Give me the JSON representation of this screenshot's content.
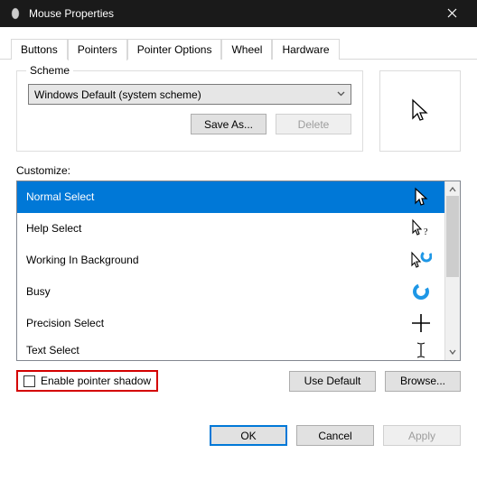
{
  "title": "Mouse Properties",
  "tabs": {
    "buttons": "Buttons",
    "pointers": "Pointers",
    "pointer_options": "Pointer Options",
    "wheel": "Wheel",
    "hardware": "Hardware"
  },
  "scheme": {
    "legend": "Scheme",
    "selected": "Windows Default (system scheme)",
    "save_as": "Save As...",
    "delete": "Delete"
  },
  "customize_label": "Customize:",
  "list": {
    "normal_select": "Normal Select",
    "help_select": "Help Select",
    "working_bg": "Working In Background",
    "busy": "Busy",
    "precision": "Precision Select",
    "text_select": "Text Select"
  },
  "checkbox_label": "Enable pointer shadow",
  "buttons": {
    "use_default": "Use Default",
    "browse": "Browse...",
    "ok": "OK",
    "cancel": "Cancel",
    "apply": "Apply"
  }
}
